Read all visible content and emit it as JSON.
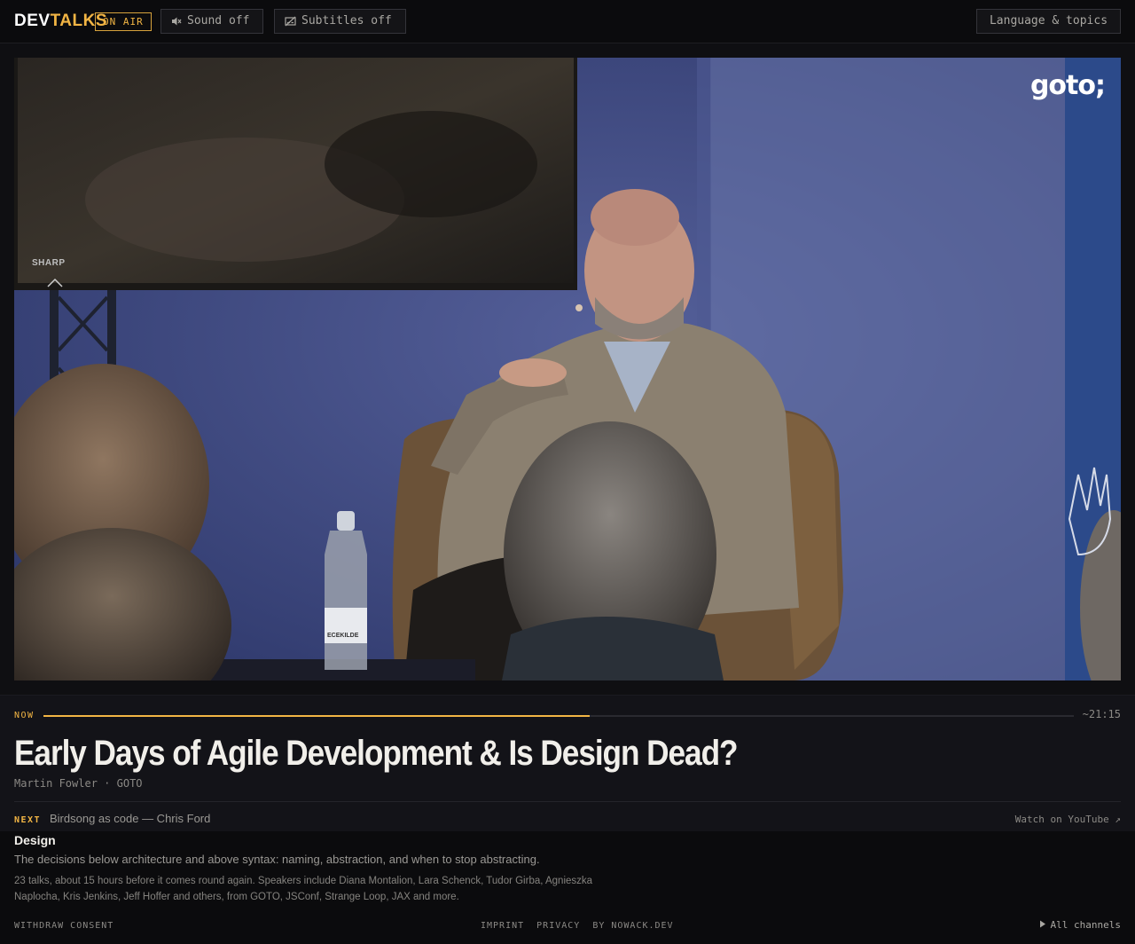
{
  "header": {
    "logo_dev": "DEV",
    "logo_talks": "TALKS",
    "live_badge": "ON AIR",
    "sound_label": "Sound off",
    "subtitles_label": "Subtitles off",
    "language_label": "Language & topics"
  },
  "video": {
    "overlay_logo": "goto;",
    "tv_brand": "SHARP",
    "bottle_label": "ECEKILDE"
  },
  "now_playing": {
    "label": "NOW",
    "progress_fraction": 0.53,
    "remaining": "~21:15",
    "title": "Early Days of Agile Development & Is Design Dead?",
    "speaker": "Martin Fowler",
    "separator": "·",
    "source": "GOTO"
  },
  "up_next": {
    "label": "NEXT",
    "title": "Birdsong as code — Chris Ford",
    "youtube_label": "Watch on YouTube ↗"
  },
  "channel": {
    "name": "Design",
    "description": "The decisions below architecture and above syntax: naming, abstraction, and when to stop abstracting.",
    "details": "23 talks, about 15 hours before it comes round again. Speakers include Diana Montalion, Lara Schenck, Tudor Girba, Agnieszka Naplocha, Kris Jenkins, Jeff Hoffer and others, from GOTO, JSConf, Strange Loop, JAX and more."
  },
  "footer": {
    "withdraw": "WITHDRAW CONSENT",
    "imprint": "IMPRINT",
    "privacy": "PRIVACY",
    "credit": "BY NOWACK.DEV",
    "all_channels": "All channels"
  },
  "colors": {
    "accent": "#f2b544",
    "background": "#0f0f12",
    "panel": "#131318"
  }
}
